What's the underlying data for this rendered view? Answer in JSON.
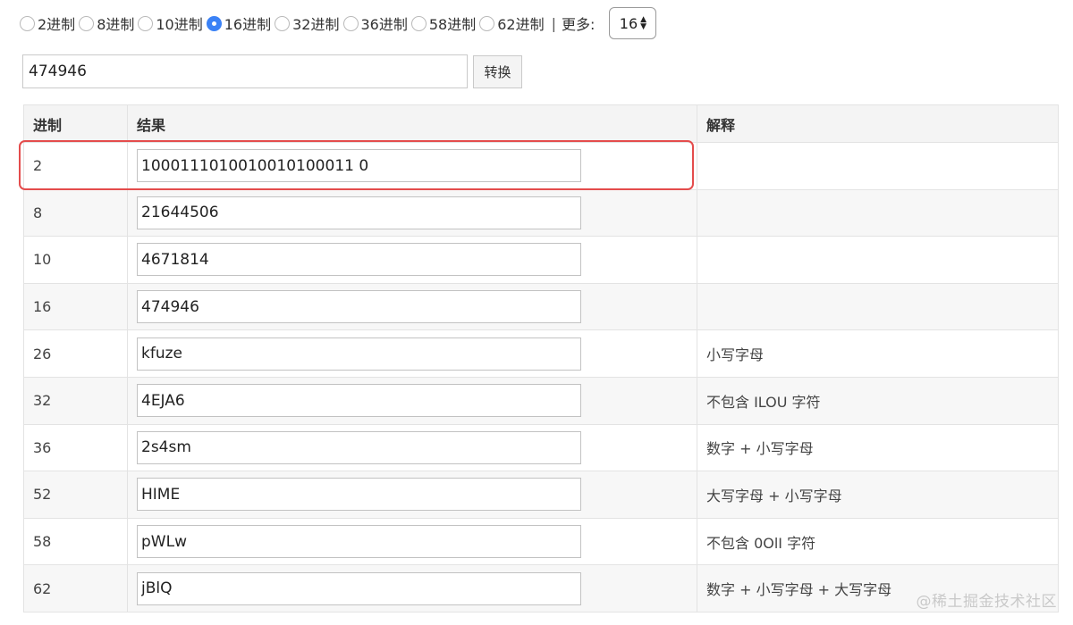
{
  "radios": [
    {
      "label": "2进制",
      "checked": false
    },
    {
      "label": "8进制",
      "checked": false
    },
    {
      "label": "10进制",
      "checked": false
    },
    {
      "label": "16进制",
      "checked": true
    },
    {
      "label": "32进制",
      "checked": false
    },
    {
      "label": "36进制",
      "checked": false
    },
    {
      "label": "58进制",
      "checked": false
    },
    {
      "label": "62进制",
      "checked": false
    }
  ],
  "separator": "|",
  "more_label": "更多:",
  "select_value": "16",
  "input_value": "474946",
  "convert_button": "转换",
  "table": {
    "headers": [
      "进制",
      "结果",
      "解释"
    ],
    "rows": [
      {
        "base": "2",
        "value": "1000111010010010100011 0",
        "note": ""
      },
      {
        "base": "8",
        "value": "21644506",
        "note": ""
      },
      {
        "base": "10",
        "value": "4671814",
        "note": ""
      },
      {
        "base": "16",
        "value": "474946",
        "note": ""
      },
      {
        "base": "26",
        "value": "kfuze",
        "note": "小写字母"
      },
      {
        "base": "32",
        "value": "4EJA6",
        "note": "不包含 ILOU 字符"
      },
      {
        "base": "36",
        "value": "2s4sm",
        "note": "数字 + 小写字母"
      },
      {
        "base": "52",
        "value": "HIME",
        "note": "大写字母 + 小写字母"
      },
      {
        "base": "58",
        "value": "pWLw",
        "note": "不包含 0OlI 字符"
      },
      {
        "base": "62",
        "value": "jBlQ",
        "note": "数字 + 小写字母 + 大写字母"
      }
    ]
  },
  "watermark": "@稀土掘金技术社区",
  "colors": {
    "accent": "#3b82f6",
    "highlight": "#e44c4c"
  }
}
